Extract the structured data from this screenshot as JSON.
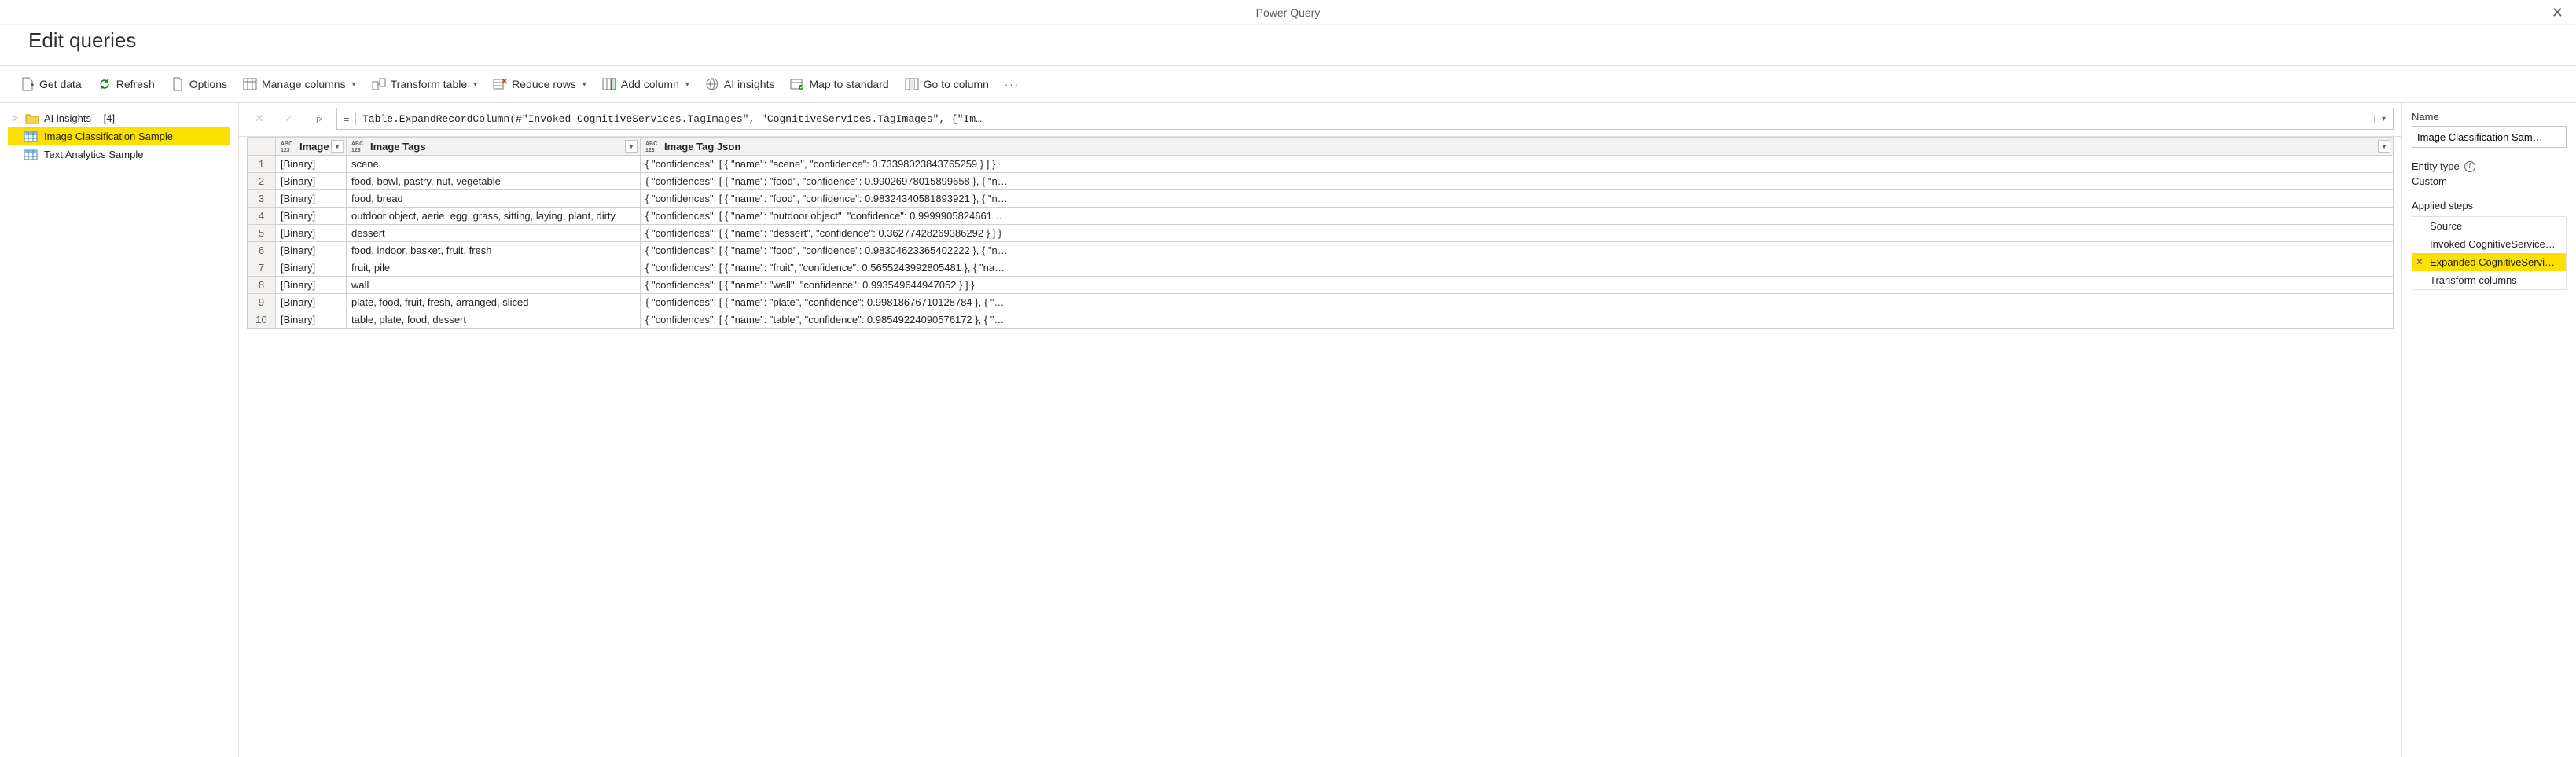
{
  "window": {
    "title": "Power Query",
    "header": "Edit queries"
  },
  "toolbar": {
    "getData": "Get data",
    "refresh": "Refresh",
    "options": "Options",
    "manageColumns": "Manage columns",
    "transformTable": "Transform table",
    "reduceRows": "Reduce rows",
    "addColumn": "Add column",
    "aiInsights": "AI insights",
    "mapToStandard": "Map to standard",
    "goToColumn": "Go to column"
  },
  "nav": {
    "group": {
      "label": "AI insights",
      "count": "[4]"
    },
    "items": [
      {
        "label": "Image Classification Sample",
        "selected": true
      },
      {
        "label": "Text Analytics Sample",
        "selected": false
      }
    ]
  },
  "formula": "Table.ExpandRecordColumn(#\"Invoked CognitiveServices.TagImages\", \"CognitiveServices.TagImages\", {\"Im…",
  "columns": [
    "Image",
    "Image Tags",
    "Image Tag Json"
  ],
  "rows": [
    {
      "n": "1",
      "img": "[Binary]",
      "tags": "scene",
      "json": "{ \"confidences\": [ { \"name\": \"scene\", \"confidence\": 0.73398023843765259 } ] }"
    },
    {
      "n": "2",
      "img": "[Binary]",
      "tags": "food, bowl, pastry, nut, vegetable",
      "json": "{ \"confidences\": [ { \"name\": \"food\", \"confidence\": 0.99026978015899658 }, { \"n…"
    },
    {
      "n": "3",
      "img": "[Binary]",
      "tags": "food, bread",
      "json": "{ \"confidences\": [ { \"name\": \"food\", \"confidence\": 0.98324340581893921 }, { \"n…"
    },
    {
      "n": "4",
      "img": "[Binary]",
      "tags": "outdoor object, aerie, egg, grass, sitting, laying, plant, dirty",
      "json": "{ \"confidences\": [ { \"name\": \"outdoor object\", \"confidence\": 0.9999905824661…"
    },
    {
      "n": "5",
      "img": "[Binary]",
      "tags": "dessert",
      "json": "{ \"confidences\": [ { \"name\": \"dessert\", \"confidence\": 0.36277428269386292 } ] }"
    },
    {
      "n": "6",
      "img": "[Binary]",
      "tags": "food, indoor, basket, fruit, fresh",
      "json": "{ \"confidences\": [ { \"name\": \"food\", \"confidence\": 0.98304623365402222 }, { \"n…"
    },
    {
      "n": "7",
      "img": "[Binary]",
      "tags": "fruit, pile",
      "json": "{ \"confidences\": [ { \"name\": \"fruit\", \"confidence\": 0.5655243992805481 }, { \"na…"
    },
    {
      "n": "8",
      "img": "[Binary]",
      "tags": "wall",
      "json": "{ \"confidences\": [ { \"name\": \"wall\", \"confidence\": 0.993549644947052 } ] }"
    },
    {
      "n": "9",
      "img": "[Binary]",
      "tags": "plate, food, fruit, fresh, arranged, sliced",
      "json": "{ \"confidences\": [ { \"name\": \"plate\", \"confidence\": 0.99818676710128784 }, { \"…"
    },
    {
      "n": "10",
      "img": "[Binary]",
      "tags": "table, plate, food, dessert",
      "json": "{ \"confidences\": [ { \"name\": \"table\", \"confidence\": 0.98549224090576172 }, { \"…"
    }
  ],
  "props": {
    "nameLabel": "Name",
    "nameValue": "Image Classification Sam…",
    "entityTypeLabel": "Entity type",
    "entityTypeValue": "Custom",
    "stepsLabel": "Applied steps",
    "steps": [
      {
        "label": "Source",
        "selected": false
      },
      {
        "label": "Invoked CognitiveService…",
        "selected": false
      },
      {
        "label": "Expanded CognitiveServic…",
        "selected": true
      },
      {
        "label": "Transform columns",
        "selected": false
      }
    ]
  }
}
